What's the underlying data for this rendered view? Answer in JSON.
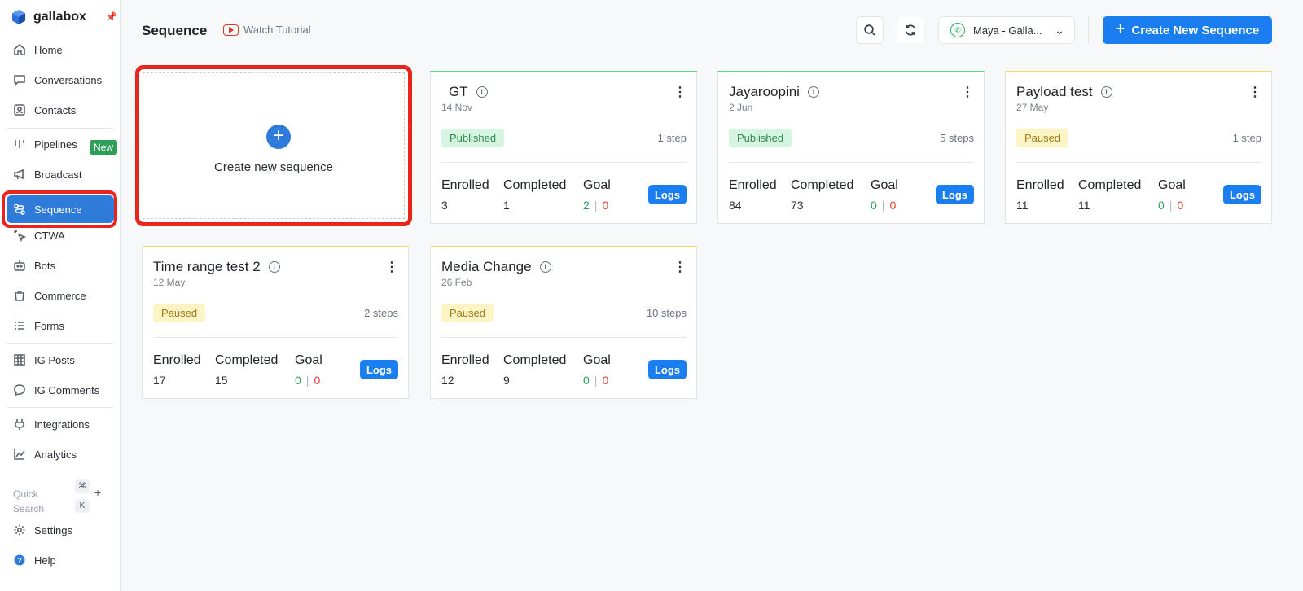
{
  "sidebar": {
    "brand": "gallabox",
    "items": [
      {
        "label": "Home"
      },
      {
        "label": "Conversations"
      },
      {
        "label": "Contacts"
      },
      {
        "label": "Pipelines",
        "badge": "New"
      },
      {
        "label": "Broadcast"
      },
      {
        "label": "Sequence"
      },
      {
        "label": "CTWA"
      },
      {
        "label": "Bots"
      },
      {
        "label": "Commerce"
      },
      {
        "label": "Forms"
      },
      {
        "label": "IG Posts"
      },
      {
        "label": "IG Comments"
      },
      {
        "label": "Integrations"
      },
      {
        "label": "Analytics"
      },
      {
        "label": "Settings"
      },
      {
        "label": "Help"
      }
    ],
    "quick_search": {
      "label": "Quick Search",
      "key1": "⌘",
      "plus": "+",
      "key2": "K"
    }
  },
  "header": {
    "title": "Sequence",
    "watch_tutorial": "Watch Tutorial",
    "account": "Maya - Galla...",
    "create_button": "Create New Sequence"
  },
  "new_card": {
    "label": "Create new sequence"
  },
  "stat_labels": {
    "enrolled": "Enrolled",
    "completed": "Completed",
    "goal": "Goal",
    "logs": "Logs",
    "separator": "|"
  },
  "cards": [
    {
      "title": "GT",
      "date": "14 Nov",
      "status": "Published",
      "steps": "1 step",
      "enrolled": "3",
      "completed": "1",
      "goal_ok": "2",
      "goal_fail": "0"
    },
    {
      "title": "Jayaroopini",
      "date": "2 Jun",
      "status": "Published",
      "steps": "5 steps",
      "enrolled": "84",
      "completed": "73",
      "goal_ok": "0",
      "goal_fail": "0"
    },
    {
      "title": "Payload test",
      "date": "27 May",
      "status": "Paused",
      "steps": "1 step",
      "enrolled": "11",
      "completed": "11",
      "goal_ok": "0",
      "goal_fail": "0"
    },
    {
      "title": "Time range test 2",
      "date": "12 May",
      "status": "Paused",
      "steps": "2 steps",
      "enrolled": "17",
      "completed": "15",
      "goal_ok": "0",
      "goal_fail": "0"
    },
    {
      "title": "Media Change",
      "date": "26 Feb",
      "status": "Paused",
      "steps": "10 steps",
      "enrolled": "12",
      "completed": "9",
      "goal_ok": "0",
      "goal_fail": "0"
    }
  ],
  "colors": {
    "primary": "#1a7ef0",
    "published": "#2f8a4f",
    "paused": "#a07a13",
    "highlight": "#e8251c"
  }
}
